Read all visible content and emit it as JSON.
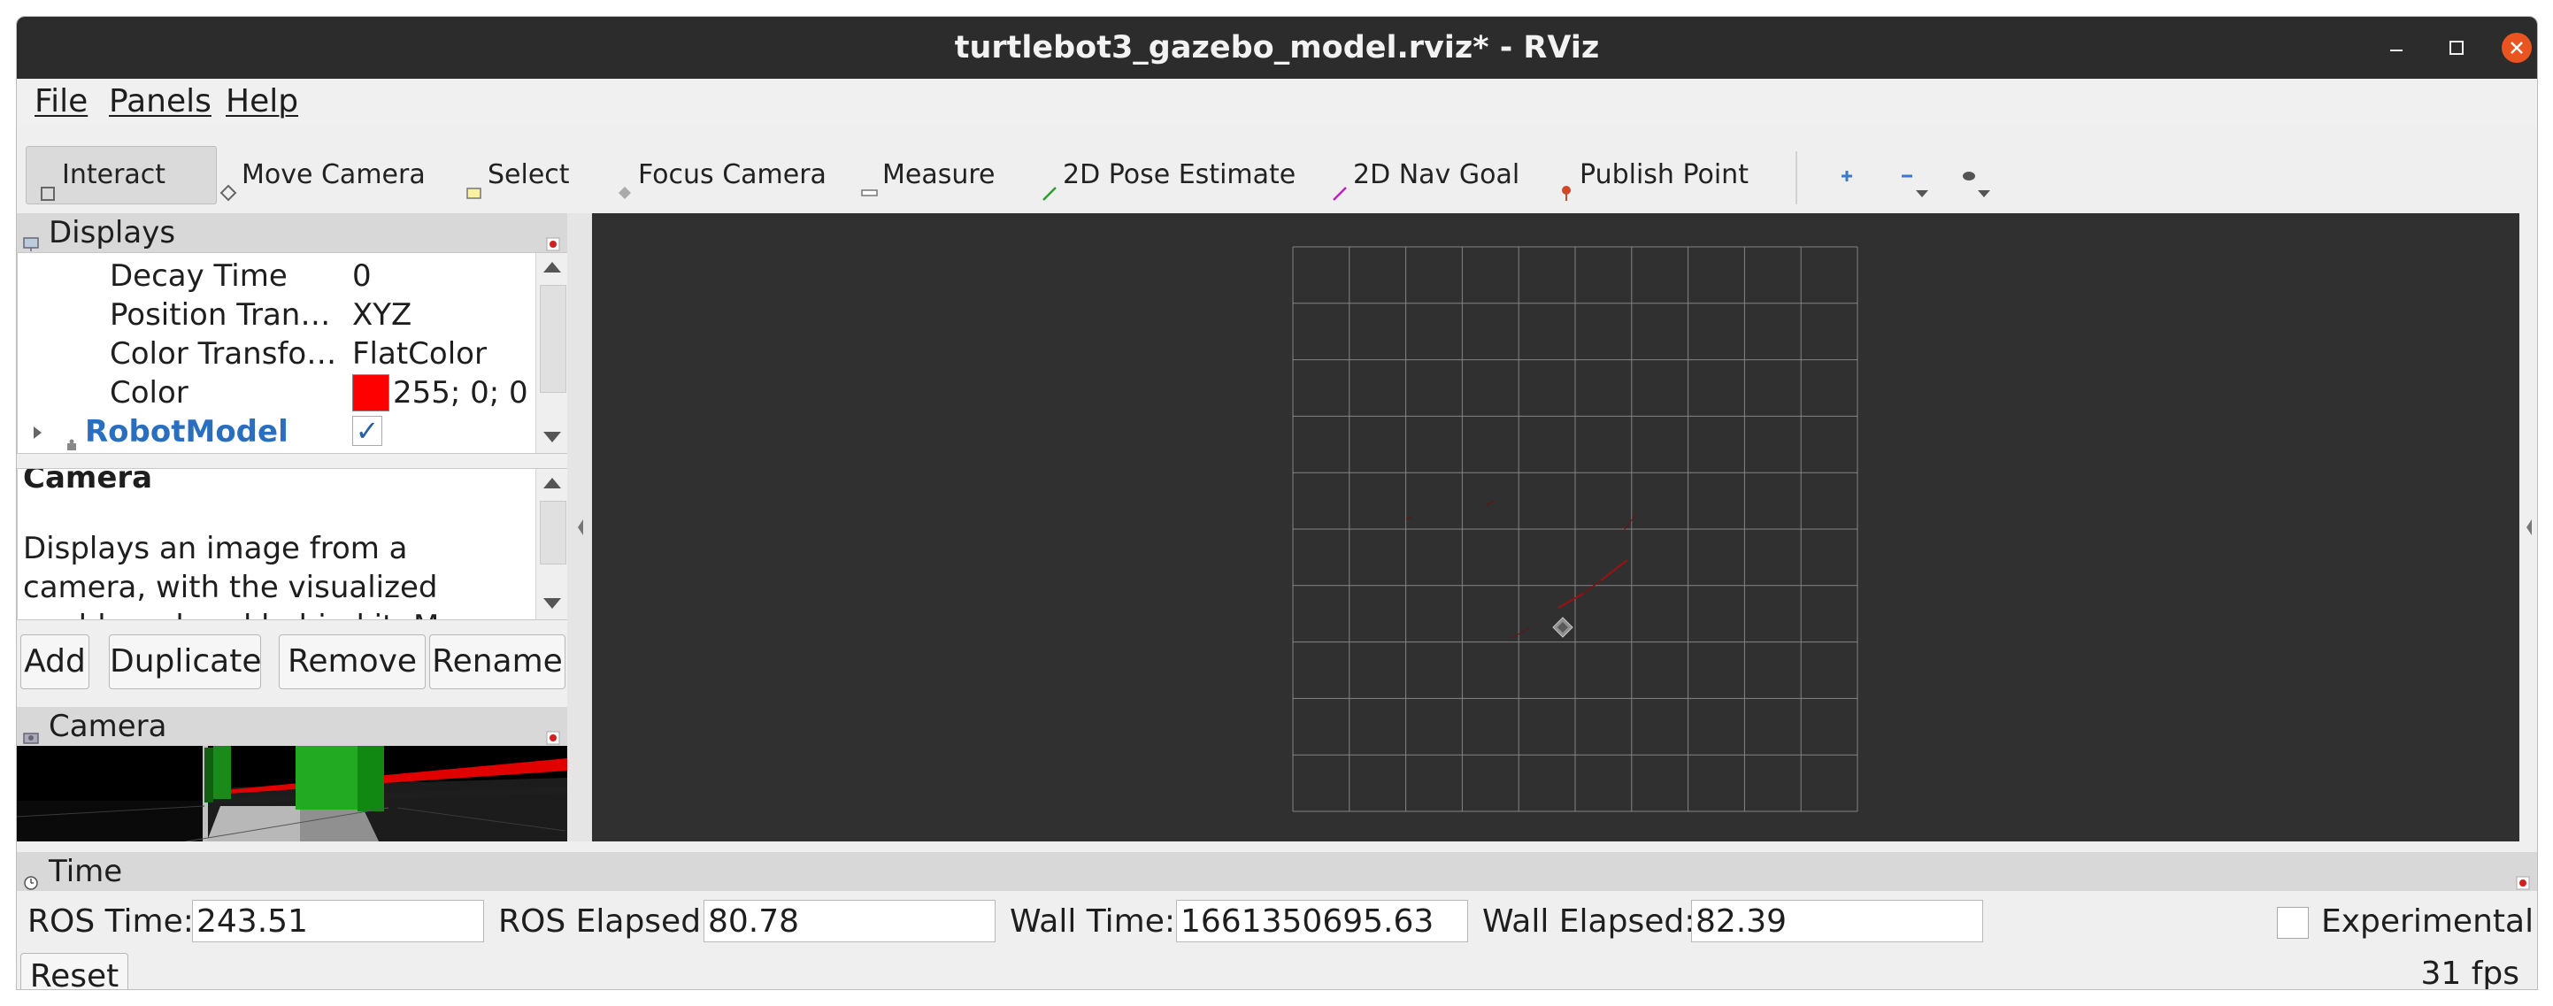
{
  "window": {
    "title": "turtlebot3_gazebo_model.rviz* - RViz"
  },
  "menubar": {
    "items": [
      "File",
      "Panels",
      "Help"
    ]
  },
  "toolbar": {
    "tools": [
      {
        "label": "Interact",
        "icon": "interact-icon",
        "active": true
      },
      {
        "label": "Move Camera",
        "icon": "move-camera-icon"
      },
      {
        "label": "Select",
        "icon": "select-icon"
      },
      {
        "label": "Focus Camera",
        "icon": "focus-camera-icon"
      },
      {
        "label": "Measure",
        "icon": "measure-icon"
      },
      {
        "label": "2D Pose Estimate",
        "icon": "pose-estimate-icon"
      },
      {
        "label": "2D Nav Goal",
        "icon": "nav-goal-icon"
      },
      {
        "label": "Publish Point",
        "icon": "publish-point-icon"
      }
    ],
    "icon_buttons": [
      "add-tool-icon",
      "remove-tool-icon",
      "view-tool-icon"
    ]
  },
  "displays": {
    "title": "Displays",
    "rows": [
      {
        "key": "Decay Time",
        "value": "0"
      },
      {
        "key": "Position Tran…",
        "value": "XYZ"
      },
      {
        "key": "Color Transfo…",
        "value": "FlatColor"
      },
      {
        "key": "Color",
        "value": "255; 0; 0",
        "swatch": "#ff0000"
      }
    ],
    "robot_model": {
      "label": "RobotModel",
      "checked": true,
      "color": "#2a6fbf"
    },
    "description": {
      "title": "Camera",
      "text": "Displays an image from a camera, with the visualized world rendered behind it. More"
    },
    "buttons": [
      "Add",
      "Duplicate",
      "Remove",
      "Rename"
    ]
  },
  "camera_panel": {
    "title": "Camera"
  },
  "view3d": {
    "background": "#303030",
    "grid_color": "#a0a0a0",
    "grid_cells": 10
  },
  "time_panel": {
    "title": "Time",
    "ros_time_label": "ROS Time:",
    "ros_time": "243.51",
    "ros_elapsed_label": "ROS Elapsed:",
    "ros_elapsed": "80.78",
    "wall_time_label": "Wall Time:",
    "wall_time": "1661350695.63",
    "wall_elapsed_label": "Wall Elapsed:",
    "wall_elapsed": "82.39",
    "experimental_label": "Experimental",
    "experimental_checked": false,
    "reset_label": "Reset",
    "fps": "31 fps"
  }
}
